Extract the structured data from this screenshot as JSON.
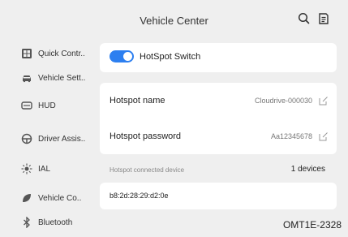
{
  "header": {
    "title": "Vehicle Center"
  },
  "sidebar": {
    "items": [
      {
        "label": "Quick Contr..",
        "icon": "grid-icon"
      },
      {
        "label": "Vehicle Sett..",
        "icon": "car-icon"
      },
      {
        "label": "HUD",
        "icon": "hud-icon"
      },
      {
        "label": "Driver Assis..",
        "icon": "steering-wheel-icon"
      },
      {
        "label": "IAL",
        "icon": "light-icon"
      },
      {
        "label": "Vehicle Co..",
        "icon": "leaf-icon"
      },
      {
        "label": "Bluetooth",
        "icon": "bluetooth-icon"
      }
    ]
  },
  "hotspot": {
    "switch_label": "HotSpot Switch",
    "switch_on": true,
    "name_label": "Hotspot name",
    "name_value": "Cloudrive-000030",
    "password_label": "Hotspot password",
    "password_value": "Aa12345678",
    "connected_label": "Hotspot connected device",
    "connected_count": "1 devices",
    "device_mac": "b8:2d:28:29:d2:0e"
  },
  "watermark": "OMT1E-2328",
  "colors": {
    "accent": "#2d7ff0",
    "background": "#efefef",
    "card": "#ffffff"
  }
}
